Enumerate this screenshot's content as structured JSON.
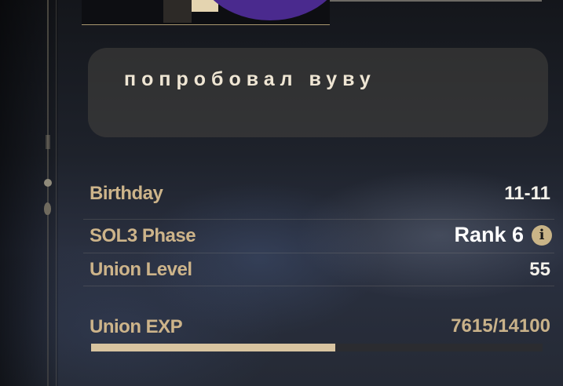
{
  "message": {
    "text": "попробовал вуву"
  },
  "stats": {
    "birthday": {
      "label": "Birthday",
      "value": "11-11"
    },
    "sol3_phase": {
      "label": "SOL3 Phase",
      "value": "Rank 6",
      "info_icon": "info-icon"
    },
    "union_level": {
      "label": "Union Level",
      "value": "55"
    }
  },
  "union_exp": {
    "label": "Union EXP",
    "value": "7615/14100",
    "current": 7615,
    "max": 14100
  },
  "colors": {
    "accent_gold": "#cdb48a",
    "bar_fill": "#d8c4a0",
    "avatar_purple": "#4a2a8e"
  }
}
